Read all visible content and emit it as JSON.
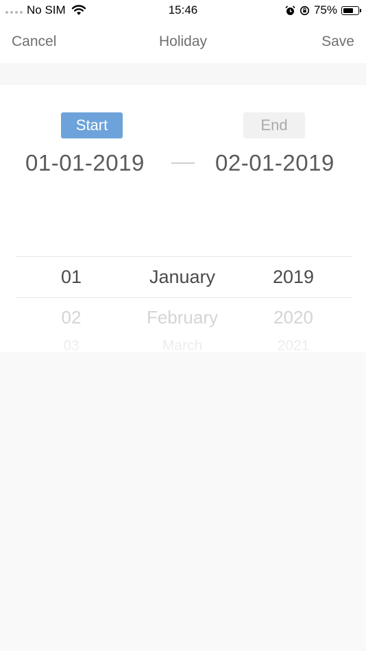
{
  "status_bar": {
    "carrier": "No SIM",
    "time": "15:46",
    "battery_percent_label": "75%",
    "battery_level": 0.75,
    "icons": [
      "signal-dots-icon",
      "wifi-icon",
      "alarm-icon",
      "orientation-lock-icon",
      "battery-icon"
    ]
  },
  "nav": {
    "cancel_label": "Cancel",
    "title": "Holiday",
    "save_label": "Save"
  },
  "range": {
    "start_tag": "Start",
    "end_tag": "End",
    "start_date": "01-01-2019",
    "end_date": "02-01-2019",
    "active_tag": "start"
  },
  "picker": {
    "days": [
      "01",
      "02",
      "03"
    ],
    "months": [
      "January",
      "February",
      "March"
    ],
    "years": [
      "2019",
      "2020",
      "2021"
    ]
  },
  "colors": {
    "accent": "#6da3da",
    "inactive_tag_bg": "#f1f1f1"
  }
}
